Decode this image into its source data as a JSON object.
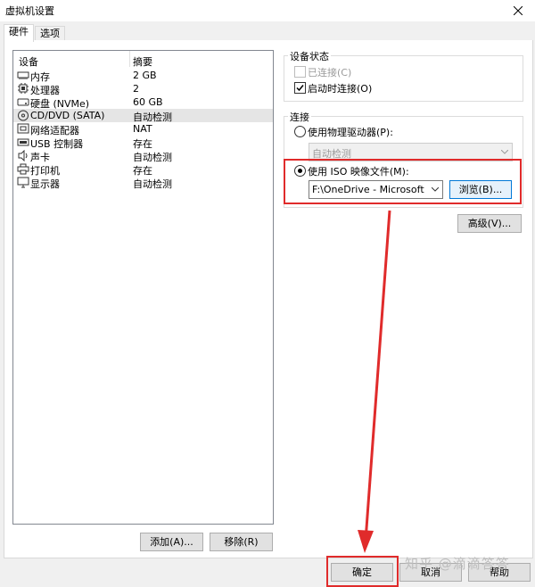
{
  "window": {
    "title": "虚拟机设置"
  },
  "tabs": [
    {
      "label": "硬件"
    },
    {
      "label": "选项"
    }
  ],
  "device_list": {
    "header_device": "设备",
    "header_summary": "摘要",
    "rows": [
      {
        "icon": "memory-icon",
        "name": "内存",
        "summary": "2 GB"
      },
      {
        "icon": "cpu-icon",
        "name": "处理器",
        "summary": "2"
      },
      {
        "icon": "disk-icon",
        "name": "硬盘 (NVMe)",
        "summary": "60 GB"
      },
      {
        "icon": "cd-icon",
        "name": "CD/DVD (SATA)",
        "summary": "自动检测"
      },
      {
        "icon": "network-icon",
        "name": "网络适配器",
        "summary": "NAT"
      },
      {
        "icon": "usb-icon",
        "name": "USB 控制器",
        "summary": "存在"
      },
      {
        "icon": "sound-icon",
        "name": "声卡",
        "summary": "自动检测"
      },
      {
        "icon": "printer-icon",
        "name": "打印机",
        "summary": "存在"
      },
      {
        "icon": "display-icon",
        "name": "显示器",
        "summary": "自动检测"
      }
    ],
    "add_button": "添加(A)...",
    "remove_button": "移除(R)"
  },
  "device_status": {
    "title": "设备状态",
    "connected": "已连接(C)",
    "connect_on_power": "启动时连接(O)"
  },
  "connection": {
    "title": "连接",
    "physical_drive": "使用物理驱动器(P):",
    "physical_drive_value": "自动检测",
    "iso_image": "使用 ISO 映像文件(M):",
    "iso_path": "F:\\OneDrive - Microsoft Clou",
    "browse_button": "浏览(B)..."
  },
  "advanced_button": "高级(V)...",
  "footer": {
    "ok": "确定",
    "cancel": "取消",
    "help": "帮助"
  },
  "watermark": "知乎 @滴滴答答",
  "colors": {
    "highlight": "#e02b2b"
  }
}
